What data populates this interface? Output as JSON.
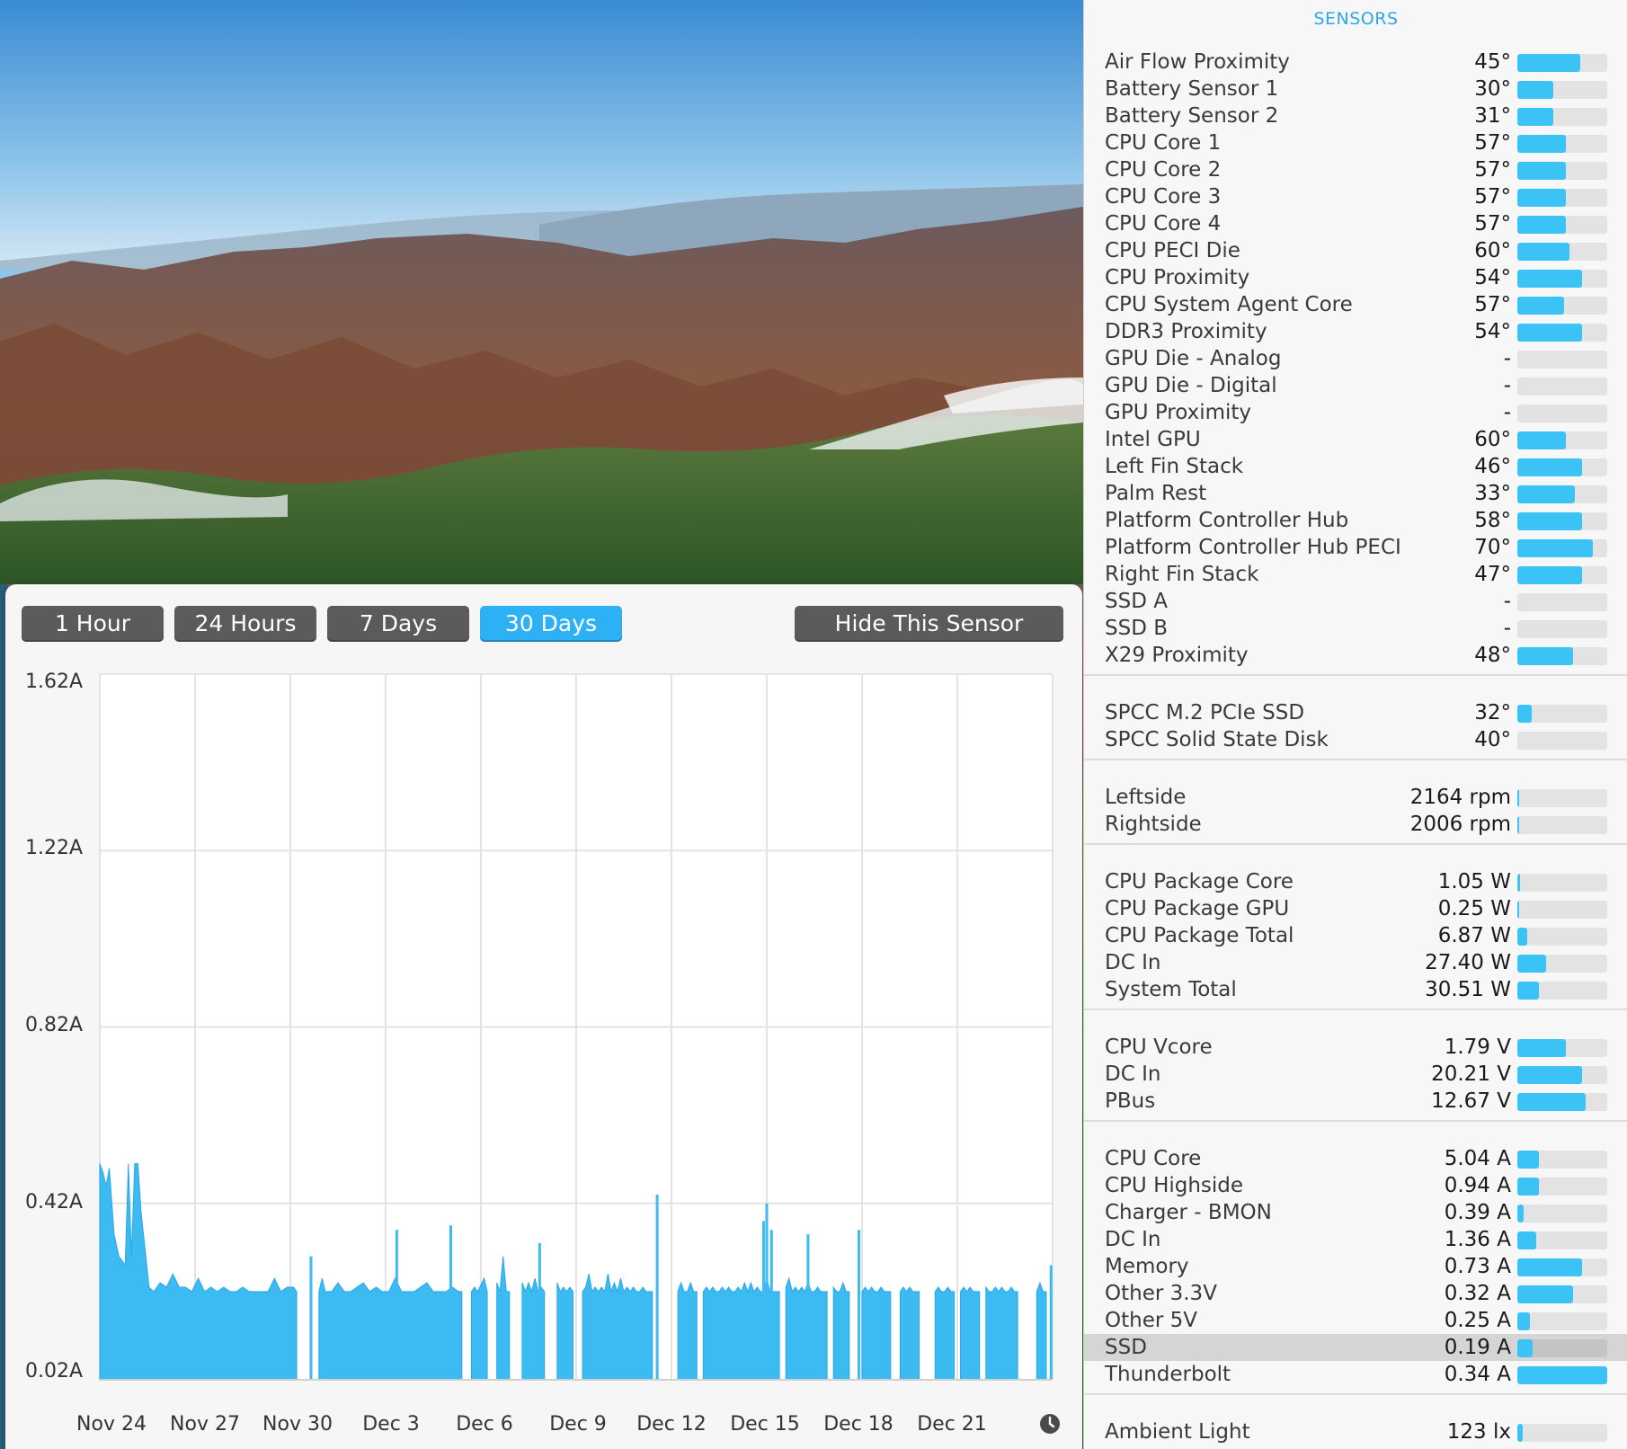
{
  "range_buttons": [
    {
      "label": "1 Hour",
      "active": false
    },
    {
      "label": "24 Hours",
      "active": false
    },
    {
      "label": "7 Days",
      "active": false
    },
    {
      "label": "30 Days",
      "active": true
    }
  ],
  "hide_button_label": "Hide This Sensor",
  "chart_data": {
    "type": "area",
    "y_ticks": [
      "1.62A",
      "1.22A",
      "0.82A",
      "0.42A",
      "0.02A"
    ],
    "ylim": [
      0.02,
      1.62
    ],
    "x_ticks": [
      "Nov 24",
      "Nov 27",
      "Nov 30",
      "Dec 3",
      "Dec 6",
      "Dec 9",
      "Dec 12",
      "Dec 15",
      "Dec 18",
      "Dec 21"
    ],
    "x_range_days": [
      0,
      30
    ],
    "grid": true,
    "color": "#3cbaf2",
    "segments": [
      {
        "points": [
          [
            0,
            0.51
          ],
          [
            0.1,
            0.49
          ],
          [
            0.2,
            0.46
          ],
          [
            0.3,
            0.5
          ],
          [
            0.45,
            0.35
          ],
          [
            0.6,
            0.3
          ],
          [
            0.8,
            0.28
          ],
          [
            0.9,
            0.51
          ],
          [
            1.0,
            0.3
          ],
          [
            1.1,
            0.51
          ],
          [
            1.2,
            0.51
          ],
          [
            1.3,
            0.4
          ],
          [
            1.45,
            0.3
          ],
          [
            1.55,
            0.23
          ],
          [
            1.7,
            0.22
          ],
          [
            1.9,
            0.24
          ],
          [
            2.1,
            0.23
          ],
          [
            2.3,
            0.26
          ],
          [
            2.5,
            0.23
          ],
          [
            2.7,
            0.23
          ],
          [
            2.9,
            0.22
          ],
          [
            3.1,
            0.25
          ],
          [
            3.3,
            0.22
          ],
          [
            3.5,
            0.23
          ],
          [
            3.7,
            0.22
          ],
          [
            3.9,
            0.23
          ],
          [
            4.1,
            0.22
          ],
          [
            4.3,
            0.22
          ],
          [
            4.5,
            0.23
          ],
          [
            4.7,
            0.22
          ],
          [
            4.9,
            0.22
          ],
          [
            5.1,
            0.22
          ],
          [
            5.3,
            0.22
          ],
          [
            5.5,
            0.25
          ],
          [
            5.7,
            0.22
          ],
          [
            5.9,
            0.23
          ],
          [
            6.1,
            0.23
          ],
          [
            6.2,
            0.22
          ]
        ]
      },
      {
        "points": [
          [
            6.9,
            0.22
          ],
          [
            7.0,
            0.25
          ],
          [
            7.1,
            0.22
          ],
          [
            7.3,
            0.22
          ],
          [
            7.5,
            0.24
          ],
          [
            7.7,
            0.22
          ],
          [
            7.9,
            0.22
          ],
          [
            8.1,
            0.23
          ],
          [
            8.3,
            0.24
          ],
          [
            8.5,
            0.22
          ],
          [
            8.7,
            0.23
          ],
          [
            8.9,
            0.22
          ],
          [
            9.1,
            0.22
          ],
          [
            9.3,
            0.25
          ],
          [
            9.5,
            0.22
          ],
          [
            9.7,
            0.22
          ],
          [
            9.9,
            0.22
          ],
          [
            10.1,
            0.23
          ],
          [
            10.3,
            0.24
          ],
          [
            10.5,
            0.22
          ],
          [
            10.7,
            0.22
          ],
          [
            10.9,
            0.22
          ],
          [
            11.1,
            0.23
          ],
          [
            11.3,
            0.22
          ],
          [
            11.4,
            0.22
          ]
        ]
      },
      {
        "points": [
          [
            11.7,
            0.22
          ],
          [
            11.8,
            0.23
          ],
          [
            11.9,
            0.22
          ],
          [
            12.1,
            0.25
          ],
          [
            12.2,
            0.22
          ]
        ]
      },
      {
        "points": [
          [
            12.5,
            0.24
          ],
          [
            12.6,
            0.22
          ],
          [
            12.7,
            0.3
          ],
          [
            12.8,
            0.22
          ],
          [
            12.9,
            0.22
          ]
        ]
      },
      {
        "points": [
          [
            13.3,
            0.24
          ],
          [
            13.4,
            0.22
          ],
          [
            13.5,
            0.24
          ],
          [
            13.6,
            0.22
          ],
          [
            13.7,
            0.25
          ],
          [
            13.8,
            0.22
          ],
          [
            13.9,
            0.23
          ],
          [
            14.0,
            0.22
          ]
        ]
      },
      {
        "points": [
          [
            14.4,
            0.24
          ],
          [
            14.5,
            0.22
          ],
          [
            14.6,
            0.23
          ],
          [
            14.7,
            0.22
          ],
          [
            14.8,
            0.23
          ],
          [
            14.9,
            0.22
          ]
        ]
      },
      {
        "points": [
          [
            15.2,
            0.22
          ],
          [
            15.3,
            0.23
          ],
          [
            15.4,
            0.26
          ],
          [
            15.5,
            0.22
          ],
          [
            15.6,
            0.23
          ],
          [
            15.7,
            0.22
          ],
          [
            15.8,
            0.23
          ],
          [
            15.9,
            0.22
          ],
          [
            16.0,
            0.26
          ],
          [
            16.1,
            0.22
          ],
          [
            16.2,
            0.24
          ],
          [
            16.3,
            0.22
          ],
          [
            16.4,
            0.25
          ],
          [
            16.5,
            0.22
          ],
          [
            16.6,
            0.23
          ],
          [
            16.7,
            0.22
          ],
          [
            16.8,
            0.23
          ],
          [
            16.9,
            0.22
          ],
          [
            17.0,
            0.22
          ],
          [
            17.1,
            0.23
          ],
          [
            17.2,
            0.22
          ],
          [
            17.4,
            0.22
          ]
        ]
      },
      {
        "points": [
          [
            18.2,
            0.22
          ],
          [
            18.3,
            0.24
          ],
          [
            18.4,
            0.22
          ],
          [
            18.5,
            0.22
          ],
          [
            18.6,
            0.24
          ],
          [
            18.7,
            0.22
          ],
          [
            18.8,
            0.22
          ]
        ]
      },
      {
        "points": [
          [
            19.0,
            0.22
          ],
          [
            19.1,
            0.23
          ],
          [
            19.2,
            0.22
          ],
          [
            19.3,
            0.23
          ],
          [
            19.4,
            0.22
          ],
          [
            19.5,
            0.22
          ],
          [
            19.6,
            0.23
          ],
          [
            19.7,
            0.22
          ],
          [
            19.8,
            0.23
          ],
          [
            19.9,
            0.22
          ],
          [
            20.0,
            0.22
          ],
          [
            20.1,
            0.23
          ],
          [
            20.2,
            0.22
          ],
          [
            20.3,
            0.24
          ],
          [
            20.4,
            0.22
          ],
          [
            20.5,
            0.24
          ],
          [
            20.6,
            0.22
          ],
          [
            20.7,
            0.23
          ],
          [
            20.8,
            0.22
          ],
          [
            20.9,
            0.22
          ],
          [
            21.0,
            0.25
          ],
          [
            21.1,
            0.22
          ],
          [
            21.2,
            0.22
          ],
          [
            21.3,
            0.22
          ],
          [
            21.4,
            0.22
          ]
        ]
      },
      {
        "points": [
          [
            21.6,
            0.23
          ],
          [
            21.7,
            0.25
          ],
          [
            21.8,
            0.22
          ],
          [
            21.9,
            0.23
          ],
          [
            22.0,
            0.22
          ],
          [
            22.1,
            0.23
          ],
          [
            22.2,
            0.22
          ],
          [
            22.3,
            0.24
          ],
          [
            22.4,
            0.22
          ],
          [
            22.5,
            0.22
          ],
          [
            22.6,
            0.23
          ],
          [
            22.7,
            0.22
          ],
          [
            22.8,
            0.22
          ],
          [
            22.9,
            0.22
          ]
        ]
      },
      {
        "points": [
          [
            23.1,
            0.23
          ],
          [
            23.2,
            0.22
          ],
          [
            23.3,
            0.22
          ],
          [
            23.4,
            0.24
          ],
          [
            23.5,
            0.22
          ],
          [
            23.6,
            0.22
          ]
        ]
      },
      {
        "points": [
          [
            24.0,
            0.22
          ],
          [
            24.1,
            0.23
          ],
          [
            24.2,
            0.22
          ],
          [
            24.3,
            0.23
          ],
          [
            24.4,
            0.22
          ],
          [
            24.5,
            0.22
          ],
          [
            24.6,
            0.23
          ],
          [
            24.7,
            0.22
          ],
          [
            24.8,
            0.22
          ],
          [
            24.9,
            0.22
          ]
        ]
      },
      {
        "points": [
          [
            25.2,
            0.22
          ],
          [
            25.3,
            0.23
          ],
          [
            25.4,
            0.22
          ],
          [
            25.5,
            0.23
          ],
          [
            25.6,
            0.22
          ],
          [
            25.7,
            0.22
          ],
          [
            25.8,
            0.22
          ]
        ]
      },
      {
        "points": [
          [
            26.3,
            0.22
          ],
          [
            26.4,
            0.23
          ],
          [
            26.5,
            0.22
          ],
          [
            26.6,
            0.22
          ],
          [
            26.7,
            0.23
          ],
          [
            26.8,
            0.22
          ],
          [
            26.9,
            0.22
          ]
        ]
      },
      {
        "points": [
          [
            27.1,
            0.22
          ],
          [
            27.2,
            0.23
          ],
          [
            27.3,
            0.22
          ],
          [
            27.4,
            0.23
          ],
          [
            27.5,
            0.22
          ],
          [
            27.6,
            0.22
          ],
          [
            27.7,
            0.22
          ]
        ]
      },
      {
        "points": [
          [
            27.9,
            0.23
          ],
          [
            28.0,
            0.22
          ],
          [
            28.1,
            0.22
          ],
          [
            28.2,
            0.23
          ],
          [
            28.3,
            0.22
          ],
          [
            28.4,
            0.23
          ],
          [
            28.5,
            0.22
          ],
          [
            28.6,
            0.22
          ],
          [
            28.7,
            0.23
          ],
          [
            28.8,
            0.22
          ],
          [
            28.9,
            0.22
          ]
        ]
      },
      {
        "points": [
          [
            29.5,
            0.22
          ],
          [
            29.6,
            0.24
          ],
          [
            29.7,
            0.22
          ],
          [
            29.8,
            0.22
          ]
        ]
      }
    ],
    "spikes": [
      {
        "x": 6.65,
        "y": 0.3
      },
      {
        "x": 9.35,
        "y": 0.36
      },
      {
        "x": 11.05,
        "y": 0.37
      },
      {
        "x": 13.85,
        "y": 0.33
      },
      {
        "x": 17.55,
        "y": 0.44
      },
      {
        "x": 20.9,
        "y": 0.38
      },
      {
        "x": 21.0,
        "y": 0.42
      },
      {
        "x": 21.15,
        "y": 0.36
      },
      {
        "x": 22.3,
        "y": 0.35
      },
      {
        "x": 23.9,
        "y": 0.36
      },
      {
        "x": 29.95,
        "y": 0.28
      }
    ]
  },
  "panel_title": "SENSORS",
  "sensor_groups": [
    [
      {
        "name": "Air Flow Proximity",
        "value": "45°",
        "fill": 0.7
      },
      {
        "name": "Battery Sensor 1",
        "value": "30°",
        "fill": 0.4
      },
      {
        "name": "Battery Sensor 2",
        "value": "31°",
        "fill": 0.4
      },
      {
        "name": "CPU Core 1",
        "value": "57°",
        "fill": 0.54
      },
      {
        "name": "CPU Core 2",
        "value": "57°",
        "fill": 0.54
      },
      {
        "name": "CPU Core 3",
        "value": "57°",
        "fill": 0.54
      },
      {
        "name": "CPU Core 4",
        "value": "57°",
        "fill": 0.54
      },
      {
        "name": "CPU PECI Die",
        "value": "60°",
        "fill": 0.58
      },
      {
        "name": "CPU Proximity",
        "value": "54°",
        "fill": 0.72
      },
      {
        "name": "CPU System Agent Core",
        "value": "57°",
        "fill": 0.52
      },
      {
        "name": "DDR3 Proximity",
        "value": "54°",
        "fill": 0.72
      },
      {
        "name": "GPU Die - Analog",
        "value": "-",
        "fill": 0
      },
      {
        "name": "GPU Die - Digital",
        "value": "-",
        "fill": 0
      },
      {
        "name": "GPU Proximity",
        "value": "-",
        "fill": 0
      },
      {
        "name": "Intel GPU",
        "value": "60°",
        "fill": 0.54
      },
      {
        "name": "Left Fin Stack",
        "value": "46°",
        "fill": 0.72
      },
      {
        "name": "Palm Rest",
        "value": "33°",
        "fill": 0.64
      },
      {
        "name": "Platform Controller Hub",
        "value": "58°",
        "fill": 0.72
      },
      {
        "name": "Platform Controller Hub PECI",
        "value": "70°",
        "fill": 0.84
      },
      {
        "name": "Right Fin Stack",
        "value": "47°",
        "fill": 0.72
      },
      {
        "name": "SSD A",
        "value": "-",
        "fill": 0
      },
      {
        "name": "SSD B",
        "value": "-",
        "fill": 0
      },
      {
        "name": "X29 Proximity",
        "value": "48°",
        "fill": 0.62
      }
    ],
    [
      {
        "name": "SPCC M.2 PCIe SSD",
        "value": "32°",
        "fill": 0.16
      },
      {
        "name": "SPCC Solid State Disk",
        "value": "40°",
        "fill": 0
      }
    ],
    [
      {
        "name": "Leftside",
        "value": "2164 rpm",
        "fill": 0.02
      },
      {
        "name": "Rightside",
        "value": "2006 rpm",
        "fill": 0.02
      }
    ],
    [
      {
        "name": "CPU Package Core",
        "value": "1.05 W",
        "fill": 0.03
      },
      {
        "name": "CPU Package GPU",
        "value": "0.25 W",
        "fill": 0.02
      },
      {
        "name": "CPU Package Total",
        "value": "6.87 W",
        "fill": 0.11
      },
      {
        "name": "DC In",
        "value": "27.40 W",
        "fill": 0.32
      },
      {
        "name": "System Total",
        "value": "30.51 W",
        "fill": 0.24
      }
    ],
    [
      {
        "name": "CPU Vcore",
        "value": "1.79 V",
        "fill": 0.54
      },
      {
        "name": "DC In",
        "value": "20.21 V",
        "fill": 0.72
      },
      {
        "name": "PBus",
        "value": "12.67 V",
        "fill": 0.76
      }
    ],
    [
      {
        "name": "CPU Core",
        "value": "5.04 A",
        "fill": 0.24
      },
      {
        "name": "CPU Highside",
        "value": "0.94 A",
        "fill": 0.24
      },
      {
        "name": "Charger - BMON",
        "value": "0.39 A",
        "fill": 0.07
      },
      {
        "name": "DC In",
        "value": "1.36 A",
        "fill": 0.21
      },
      {
        "name": "Memory",
        "value": "0.73 A",
        "fill": 0.72
      },
      {
        "name": "Other 3.3V",
        "value": "0.32 A",
        "fill": 0.62
      },
      {
        "name": "Other 5V",
        "value": "0.25 A",
        "fill": 0.14
      },
      {
        "name": "SSD",
        "value": "0.19 A",
        "fill": 0.17,
        "selected": true
      },
      {
        "name": "Thunderbolt",
        "value": "0.34 A",
        "fill": 1.0
      }
    ],
    [
      {
        "name": "Ambient Light",
        "value": "123 lx",
        "fill": 0.06
      }
    ]
  ]
}
